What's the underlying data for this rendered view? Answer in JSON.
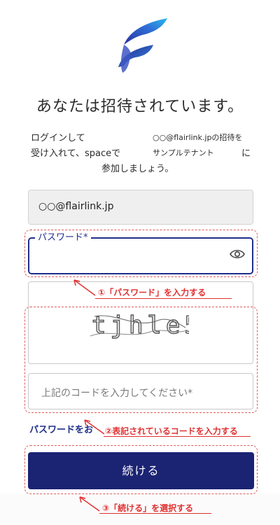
{
  "header": {
    "title": "あなたは招待されています。"
  },
  "intro": {
    "line1_start": "ログインして",
    "inviter": "○○@flairlink.jpの招待を",
    "line2_start": "受け入れて、spaceで",
    "tenant": "サンプルテナント",
    "line2_end": "に",
    "line3": "参加しましょう。"
  },
  "form": {
    "email_value": "○○@flairlink.jp",
    "password_label": "パスワード*",
    "captcha_text": "tjhle5",
    "code_placeholder": "上記のコードを入力してください*",
    "forgot_link": "パスワードをお",
    "continue_label": "続ける"
  },
  "annotations": {
    "step1": "①「パスワード」を入力する",
    "step2": "②表記されているコードを入力する",
    "step3": "③「続ける」を選択する"
  },
  "colors": {
    "primary": "#1b2373",
    "annotation": "#e03131",
    "focus": "#1f2f8a"
  }
}
